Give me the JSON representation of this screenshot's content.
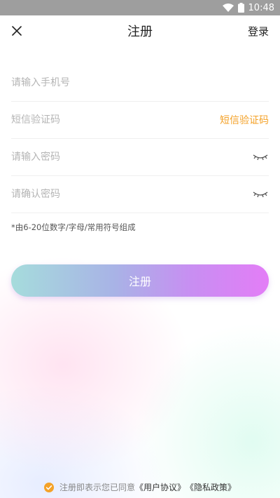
{
  "status_bar": {
    "time": "10:48"
  },
  "header": {
    "title": "注册",
    "login_label": "登录"
  },
  "form": {
    "phone_placeholder": "请输入手机号",
    "sms_placeholder": "短信验证码",
    "sms_button": "短信验证码",
    "password_placeholder": "请输入密码",
    "confirm_placeholder": "请确认密码",
    "hint": "*由6-20位数字/字母/常用符号组成"
  },
  "register_button": "注册",
  "agreement": {
    "prefix": "注册即表示您已同意",
    "user_agreement": "《用户协议》",
    "privacy_policy": "《隐私政策》"
  },
  "colors": {
    "accent": "#f4a228",
    "status_bar": "#9e9e9e",
    "gradient_start": "#a6dcdc",
    "gradient_end": "#e37df6"
  }
}
